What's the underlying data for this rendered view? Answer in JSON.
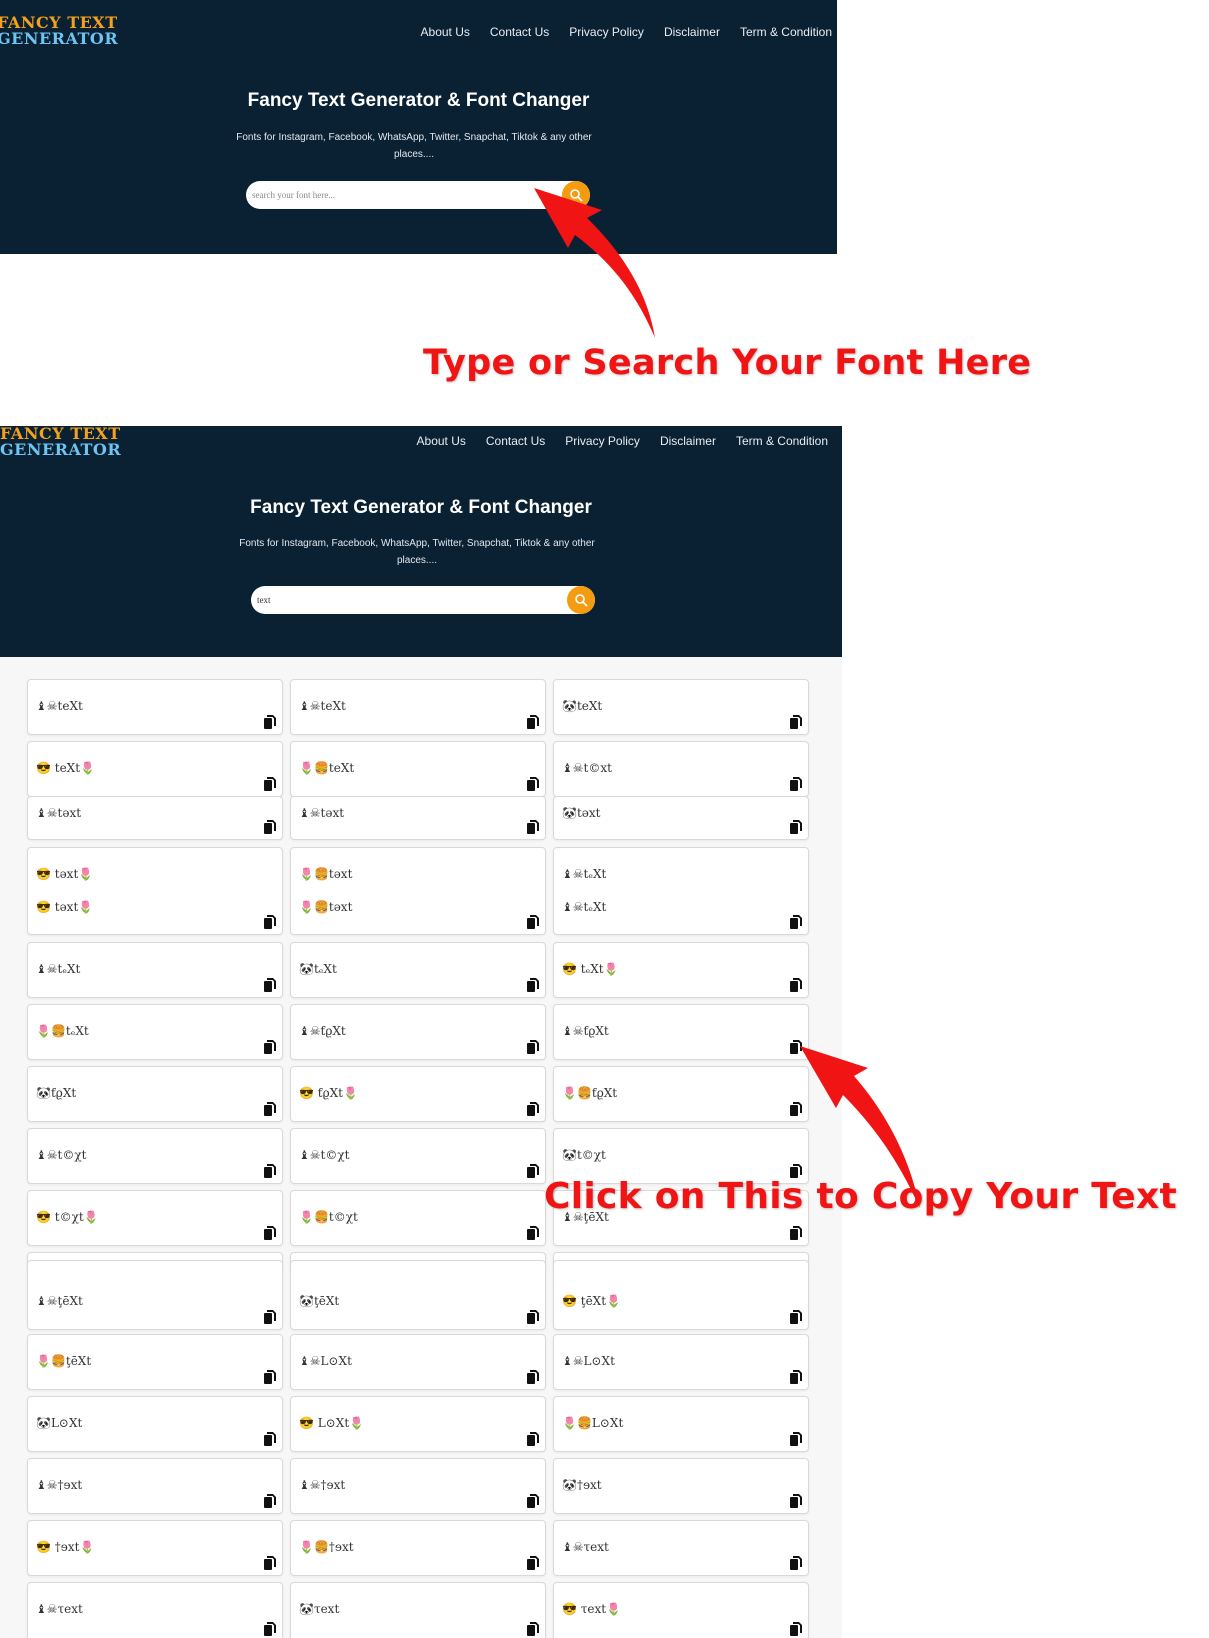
{
  "site": {
    "logo_line1": "FANCY TEXT",
    "logo_line2": "GENERATOR",
    "nav": [
      "About Us",
      "Contact Us",
      "Privacy Policy",
      "Disclaimer",
      "Term & Condition"
    ],
    "hero_title": "Fancy Text Generator & Font Changer",
    "hero_subtitle": "Fonts for Instagram, Facebook, WhatsApp, Twitter, Snapchat, Tiktok & any other places....",
    "search_placeholder": "search your font here...",
    "search_icon": "search-icon",
    "brand_colors": {
      "header_bg": "#0a2133",
      "logo_orange": "#f5a11c",
      "logo_blue": "#6ec3f0",
      "search_button": "#f39c12"
    }
  },
  "screen1": {
    "search_value": ""
  },
  "screen2": {
    "search_value": "text"
  },
  "annotations": {
    "search_hint": "Type or Search Your Font Here",
    "copy_hint": "Click on This to Copy Your Text",
    "color": "#f01414"
  },
  "results": {
    "copy_icon": "copy-icon",
    "cards": [
      [
        "♝☠teXt",
        "♝☠teXt",
        "🐼teXt"
      ],
      [
        "😎 teXt🌷",
        "🌷🍔teXt",
        "♝☠t©xt"
      ],
      [
        "♝☠təxt",
        "♝☠təxt",
        "🐼təxt"
      ],
      [
        "😎 təxt🌷",
        "🌷🍔təxt",
        "♝☠tₑXt"
      ],
      [
        "♝☠tₑXt",
        "🐼tₑXt",
        "😎 tₑXt🌷"
      ],
      [
        "🌷🍔tₑXt",
        "♝☠ƭϱⅩt",
        "♝☠ƭϱⅩt"
      ],
      [
        "🐼ƭϱⅩt",
        "😎 ƭϱⅩt🌷",
        "🌷🍔ƭϱⅩt"
      ],
      [
        "♝☠t©χt",
        "♝☠t©χt",
        "🐼t©χt"
      ],
      [
        "😎 t©χt🌷",
        "🌷🍔t©χt",
        "♝☠ţēXt"
      ],
      [
        "",
        "",
        ""
      ],
      [
        "♝☠ţēXt",
        "🐼ţēXt",
        "😎 ţēXt🌷"
      ],
      [
        "🌷🍔ţēXt",
        "♝☠L⊙Xt",
        "♝☠L⊙Xt"
      ],
      [
        "🐼L⊙Xt",
        "😎 L⊙Xt🌷",
        "🌷🍔L⊙Xt"
      ],
      [
        "♝☠†ɘxt",
        "♝☠†ɘxt",
        "🐼†ɘxt"
      ],
      [
        "😎 †ɘxt🌷",
        "🌷🍔†ɘxt",
        "♝☠τext"
      ],
      [
        "♝☠τext",
        "🐼τext",
        "😎 τext🌷"
      ]
    ],
    "card_second_lines": {
      "3": [
        "😎 təxt🌷",
        "🌷🍔təxt",
        "♝☠tₑXt"
      ]
    }
  }
}
